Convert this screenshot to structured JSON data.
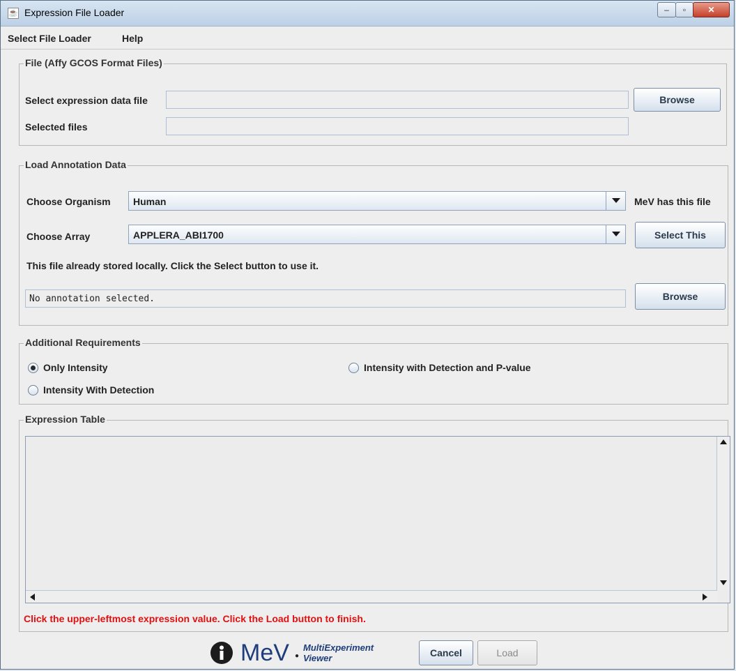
{
  "window": {
    "title": "Expression File Loader"
  },
  "menu": {
    "items": [
      "Select File Loader",
      "Help"
    ]
  },
  "file_panel": {
    "legend": "File   (Affy GCOS Format Files)",
    "expression_label": "Select expression data file",
    "expression_value": "",
    "selected_label": "Selected files",
    "selected_value": "",
    "browse_label": "Browse"
  },
  "annotation_panel": {
    "legend": "Load Annotation Data",
    "organism_label": "Choose Organism",
    "organism_value": "Human",
    "organism_status": "MeV has this file",
    "array_label": "Choose Array",
    "array_value": "APPLERA_ABI1700",
    "select_this_label": "Select This",
    "info_text": "This file already stored locally. Click the Select button to use it.",
    "annotation_field_value": "No annotation selected.",
    "browse_label": "Browse"
  },
  "requirements_panel": {
    "legend": "Additional Requirements",
    "options": [
      {
        "label": "Only Intensity",
        "selected": true
      },
      {
        "label": "Intensity with Detection and P-value",
        "selected": false
      },
      {
        "label": "Intensity With Detection",
        "selected": false
      }
    ]
  },
  "expression_panel": {
    "legend": "Expression Table",
    "status_text": "Click the upper-leftmost expression value. Click the Load button to finish."
  },
  "footer": {
    "logo_text": "MeV",
    "logo_sub1": "MultiExperiment",
    "logo_sub2": "Viewer",
    "cancel_label": "Cancel",
    "load_label": "Load"
  },
  "colors": {
    "status_red": "#e01010",
    "titlebar": "#bcd0e6",
    "close_button": "#c4402a"
  }
}
